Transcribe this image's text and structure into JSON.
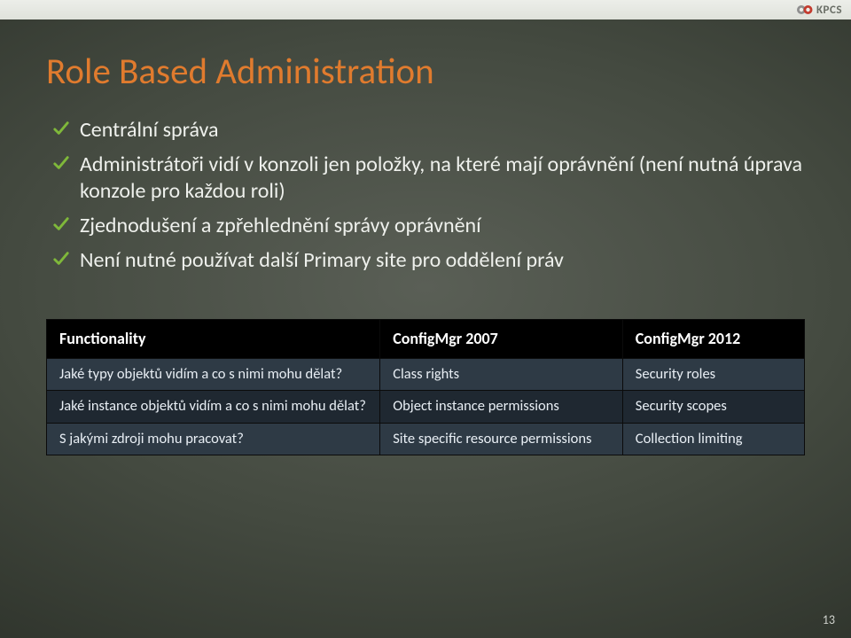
{
  "brand": {
    "name": "KPCS"
  },
  "title": "Role Based Administration",
  "bullets": [
    "Centrální správa",
    "Administrátoři vidí v konzoli jen položky, na které mají oprávnění (není nutná úprava konzole pro každou roli)",
    "Zjednodušení a zpřehlednění správy oprávnění",
    "Není nutné používat další Primary site pro oddělení práv"
  ],
  "table": {
    "headers": [
      "Functionality",
      "ConfigMgr 2007",
      "ConfigMgr 2012"
    ],
    "rows": [
      [
        "Jaké typy objektů vidím a co s nimi mohu dělat?",
        "Class rights",
        "Security roles"
      ],
      [
        "Jaké instance objektů vidím a co s nimi mohu dělat?",
        "Object instance permissions",
        "Security scopes"
      ],
      [
        "S jakými zdroji mohu pracovat?",
        "Site specific resource permissions",
        "Collection limiting"
      ]
    ]
  },
  "page_number": "13"
}
